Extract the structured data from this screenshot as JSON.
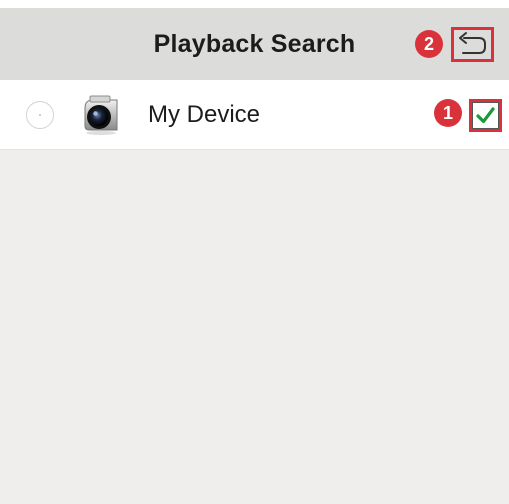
{
  "header": {
    "title": "Playback Search",
    "back_icon": "back-arrow-icon"
  },
  "annotations": {
    "step_back": "2",
    "step_check": "1",
    "color": "#d9323a"
  },
  "devices": [
    {
      "name": "My Device",
      "icon": "camera-icon",
      "selected": true
    }
  ],
  "colors": {
    "header_bg": "#dcdcda",
    "list_bg": "#efeeed",
    "check": "#1a9a3a",
    "highlight": "#d9323a"
  }
}
